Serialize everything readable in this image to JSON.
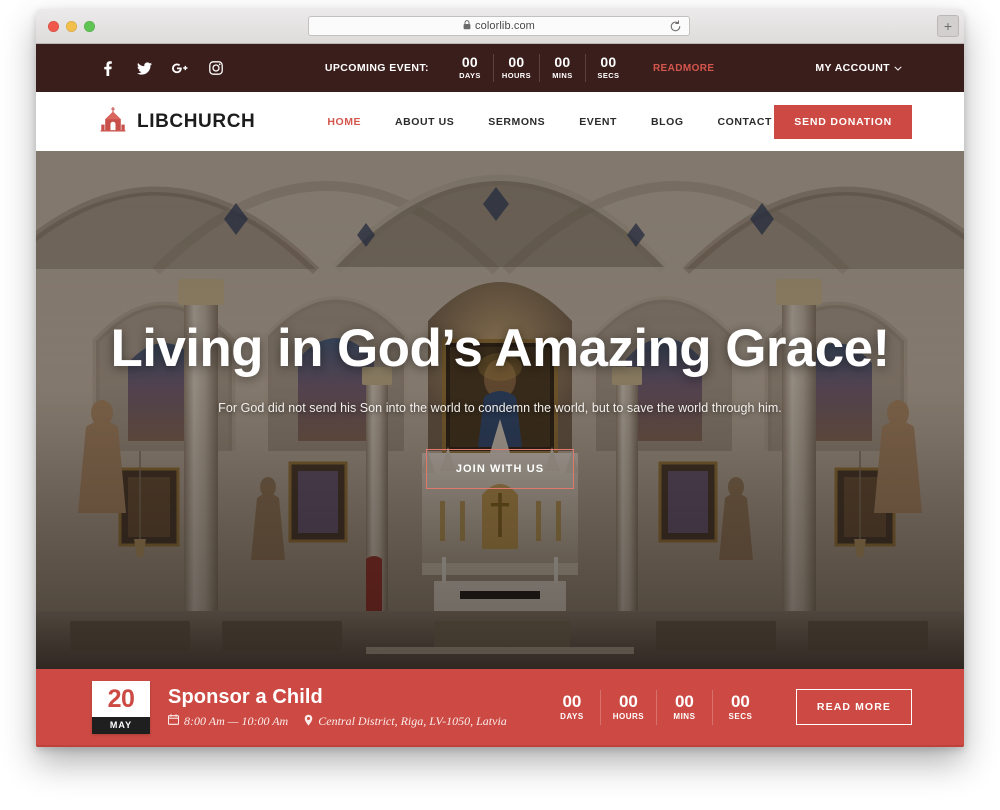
{
  "browser": {
    "url": "colorlib.com",
    "lock_icon": "lock-icon",
    "reload_icon": "reload-icon",
    "newtab_label": "+"
  },
  "topbar": {
    "background": "#3a1e1c",
    "social": [
      {
        "name": "facebook-icon",
        "label": "f"
      },
      {
        "name": "twitter-icon",
        "label": ""
      },
      {
        "name": "google-plus-icon",
        "label": "g+"
      },
      {
        "name": "instagram-icon",
        "label": ""
      }
    ],
    "upcoming_label": "UPCOMING EVENT:",
    "countdown": [
      {
        "value": "00",
        "unit": "DAYS"
      },
      {
        "value": "00",
        "unit": "HOURS"
      },
      {
        "value": "00",
        "unit": "MINS"
      },
      {
        "value": "00",
        "unit": "SECS"
      }
    ],
    "readmore": "READMORE",
    "readmore_color": "#d4564c",
    "account_label": "MY ACCOUNT",
    "account_caret": "chevron-down-icon"
  },
  "nav": {
    "logo_icon": "church-icon",
    "brand": "LIBCHURCH",
    "accent": "#d4564c",
    "links": [
      {
        "label": "HOME",
        "active": true
      },
      {
        "label": "ABOUT US",
        "active": false
      },
      {
        "label": "SERMONS",
        "active": false
      },
      {
        "label": "EVENT",
        "active": false
      },
      {
        "label": "BLOG",
        "active": false
      },
      {
        "label": "CONTACT",
        "active": false
      }
    ],
    "donate_label": "SEND DONATION",
    "donate_color": "#cc4a43"
  },
  "hero": {
    "title": "Living in God’s Amazing Grace!",
    "subtitle": "For God did not send his Son into the world to condemn the world, but to save the world through him.",
    "cta_label": "JOIN WITH US",
    "scene": "gothic cathedral interior with vaulted arches and altar"
  },
  "event": {
    "background": "#cc4a43",
    "date_day": "20",
    "date_month": "MAY",
    "title": "Sponsor a Child",
    "time_icon": "calendar-icon",
    "time": "8:00 Am — 10:00 Am",
    "location_icon": "map-pin-icon",
    "location": "Central District, Riga, LV-1050, Latvia",
    "countdown": [
      {
        "value": "00",
        "unit": "DAYS"
      },
      {
        "value": "00",
        "unit": "HOURS"
      },
      {
        "value": "00",
        "unit": "MINS"
      },
      {
        "value": "00",
        "unit": "SECS"
      }
    ],
    "readmore_label": "READ MORE"
  }
}
